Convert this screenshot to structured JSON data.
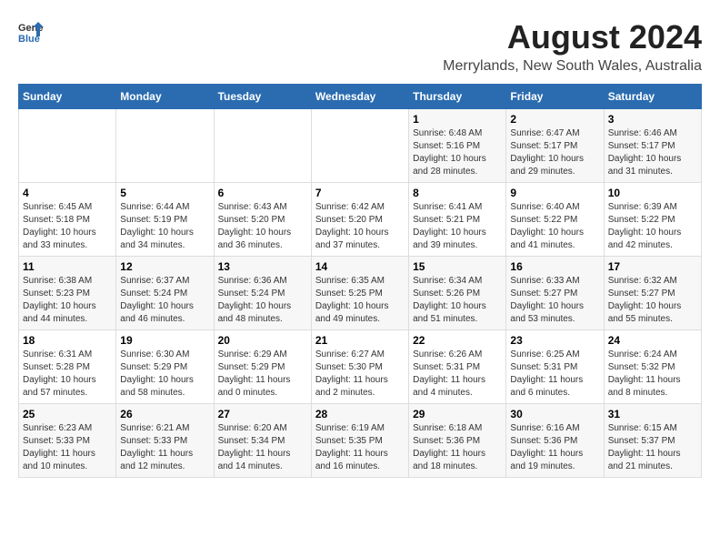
{
  "logo": {
    "general": "General",
    "blue": "Blue"
  },
  "title": "August 2024",
  "subtitle": "Merrylands, New South Wales, Australia",
  "headers": [
    "Sunday",
    "Monday",
    "Tuesday",
    "Wednesday",
    "Thursday",
    "Friday",
    "Saturday"
  ],
  "weeks": [
    [
      {
        "day": "",
        "info": ""
      },
      {
        "day": "",
        "info": ""
      },
      {
        "day": "",
        "info": ""
      },
      {
        "day": "",
        "info": ""
      },
      {
        "day": "1",
        "info": "Sunrise: 6:48 AM\nSunset: 5:16 PM\nDaylight: 10 hours\nand 28 minutes."
      },
      {
        "day": "2",
        "info": "Sunrise: 6:47 AM\nSunset: 5:17 PM\nDaylight: 10 hours\nand 29 minutes."
      },
      {
        "day": "3",
        "info": "Sunrise: 6:46 AM\nSunset: 5:17 PM\nDaylight: 10 hours\nand 31 minutes."
      }
    ],
    [
      {
        "day": "4",
        "info": "Sunrise: 6:45 AM\nSunset: 5:18 PM\nDaylight: 10 hours\nand 33 minutes."
      },
      {
        "day": "5",
        "info": "Sunrise: 6:44 AM\nSunset: 5:19 PM\nDaylight: 10 hours\nand 34 minutes."
      },
      {
        "day": "6",
        "info": "Sunrise: 6:43 AM\nSunset: 5:20 PM\nDaylight: 10 hours\nand 36 minutes."
      },
      {
        "day": "7",
        "info": "Sunrise: 6:42 AM\nSunset: 5:20 PM\nDaylight: 10 hours\nand 37 minutes."
      },
      {
        "day": "8",
        "info": "Sunrise: 6:41 AM\nSunset: 5:21 PM\nDaylight: 10 hours\nand 39 minutes."
      },
      {
        "day": "9",
        "info": "Sunrise: 6:40 AM\nSunset: 5:22 PM\nDaylight: 10 hours\nand 41 minutes."
      },
      {
        "day": "10",
        "info": "Sunrise: 6:39 AM\nSunset: 5:22 PM\nDaylight: 10 hours\nand 42 minutes."
      }
    ],
    [
      {
        "day": "11",
        "info": "Sunrise: 6:38 AM\nSunset: 5:23 PM\nDaylight: 10 hours\nand 44 minutes."
      },
      {
        "day": "12",
        "info": "Sunrise: 6:37 AM\nSunset: 5:24 PM\nDaylight: 10 hours\nand 46 minutes."
      },
      {
        "day": "13",
        "info": "Sunrise: 6:36 AM\nSunset: 5:24 PM\nDaylight: 10 hours\nand 48 minutes."
      },
      {
        "day": "14",
        "info": "Sunrise: 6:35 AM\nSunset: 5:25 PM\nDaylight: 10 hours\nand 49 minutes."
      },
      {
        "day": "15",
        "info": "Sunrise: 6:34 AM\nSunset: 5:26 PM\nDaylight: 10 hours\nand 51 minutes."
      },
      {
        "day": "16",
        "info": "Sunrise: 6:33 AM\nSunset: 5:27 PM\nDaylight: 10 hours\nand 53 minutes."
      },
      {
        "day": "17",
        "info": "Sunrise: 6:32 AM\nSunset: 5:27 PM\nDaylight: 10 hours\nand 55 minutes."
      }
    ],
    [
      {
        "day": "18",
        "info": "Sunrise: 6:31 AM\nSunset: 5:28 PM\nDaylight: 10 hours\nand 57 minutes."
      },
      {
        "day": "19",
        "info": "Sunrise: 6:30 AM\nSunset: 5:29 PM\nDaylight: 10 hours\nand 58 minutes."
      },
      {
        "day": "20",
        "info": "Sunrise: 6:29 AM\nSunset: 5:29 PM\nDaylight: 11 hours\nand 0 minutes."
      },
      {
        "day": "21",
        "info": "Sunrise: 6:27 AM\nSunset: 5:30 PM\nDaylight: 11 hours\nand 2 minutes."
      },
      {
        "day": "22",
        "info": "Sunrise: 6:26 AM\nSunset: 5:31 PM\nDaylight: 11 hours\nand 4 minutes."
      },
      {
        "day": "23",
        "info": "Sunrise: 6:25 AM\nSunset: 5:31 PM\nDaylight: 11 hours\nand 6 minutes."
      },
      {
        "day": "24",
        "info": "Sunrise: 6:24 AM\nSunset: 5:32 PM\nDaylight: 11 hours\nand 8 minutes."
      }
    ],
    [
      {
        "day": "25",
        "info": "Sunrise: 6:23 AM\nSunset: 5:33 PM\nDaylight: 11 hours\nand 10 minutes."
      },
      {
        "day": "26",
        "info": "Sunrise: 6:21 AM\nSunset: 5:33 PM\nDaylight: 11 hours\nand 12 minutes."
      },
      {
        "day": "27",
        "info": "Sunrise: 6:20 AM\nSunset: 5:34 PM\nDaylight: 11 hours\nand 14 minutes."
      },
      {
        "day": "28",
        "info": "Sunrise: 6:19 AM\nSunset: 5:35 PM\nDaylight: 11 hours\nand 16 minutes."
      },
      {
        "day": "29",
        "info": "Sunrise: 6:18 AM\nSunset: 5:36 PM\nDaylight: 11 hours\nand 18 minutes."
      },
      {
        "day": "30",
        "info": "Sunrise: 6:16 AM\nSunset: 5:36 PM\nDaylight: 11 hours\nand 19 minutes."
      },
      {
        "day": "31",
        "info": "Sunrise: 6:15 AM\nSunset: 5:37 PM\nDaylight: 11 hours\nand 21 minutes."
      }
    ]
  ]
}
